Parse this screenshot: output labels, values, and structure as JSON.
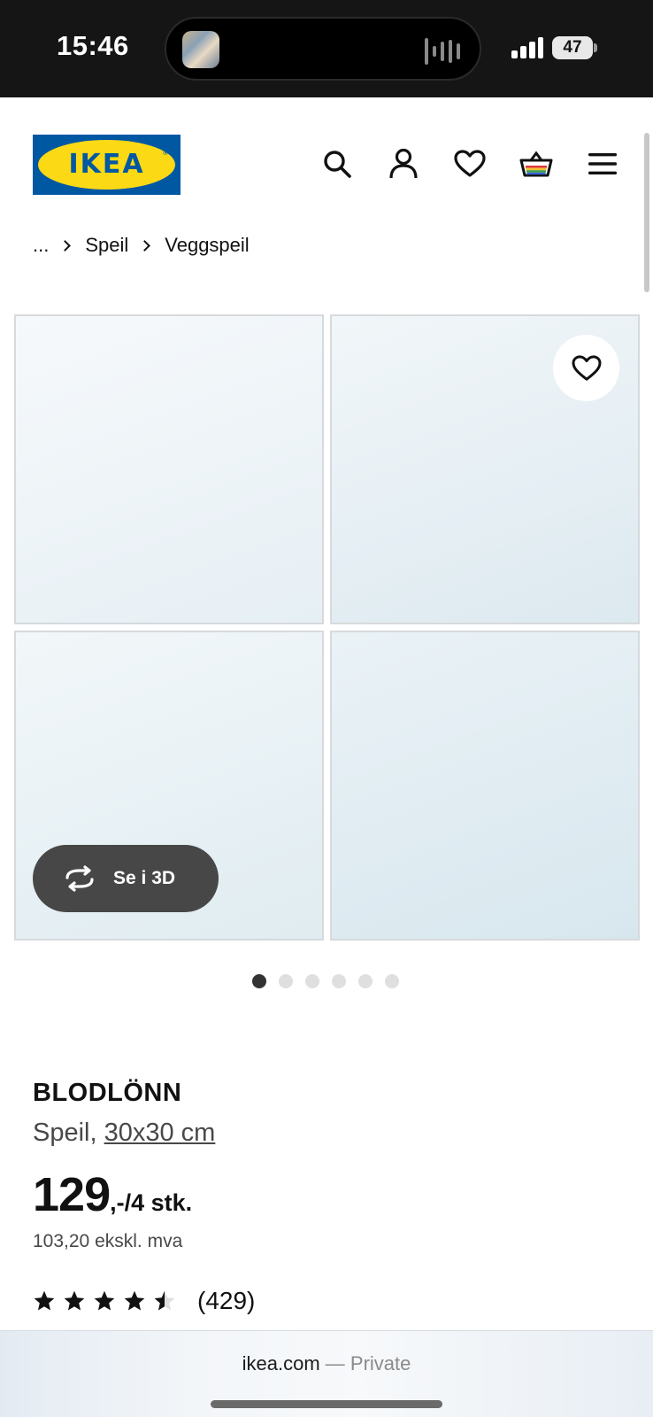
{
  "status_bar": {
    "time": "15:46",
    "battery": "47"
  },
  "header": {
    "logo_text": "IKEA",
    "icons": [
      "search-icon",
      "user-icon",
      "heart-icon",
      "shopping-basket-icon",
      "menu-icon"
    ]
  },
  "breadcrumb": {
    "items": [
      "...",
      "Speil",
      "Veggspeil"
    ]
  },
  "gallery": {
    "view_3d_label": "Se i 3D",
    "slide_count": 6,
    "active_slide": 1
  },
  "product": {
    "name": "BLODLÖNN",
    "type": "Speil,",
    "size": "30x30 cm",
    "price_main": "129",
    "price_suffix": ",-/4 stk.",
    "price_ex_vat": "103,20 ekskl. mva",
    "rating": 4.5,
    "rating_count": "(429)"
  },
  "browser": {
    "domain": "ikea.com",
    "mode": "— Private"
  },
  "colors": {
    "ikea_blue": "#0058a3",
    "ikea_yellow": "#fbd914",
    "button_dark": "#474747"
  }
}
